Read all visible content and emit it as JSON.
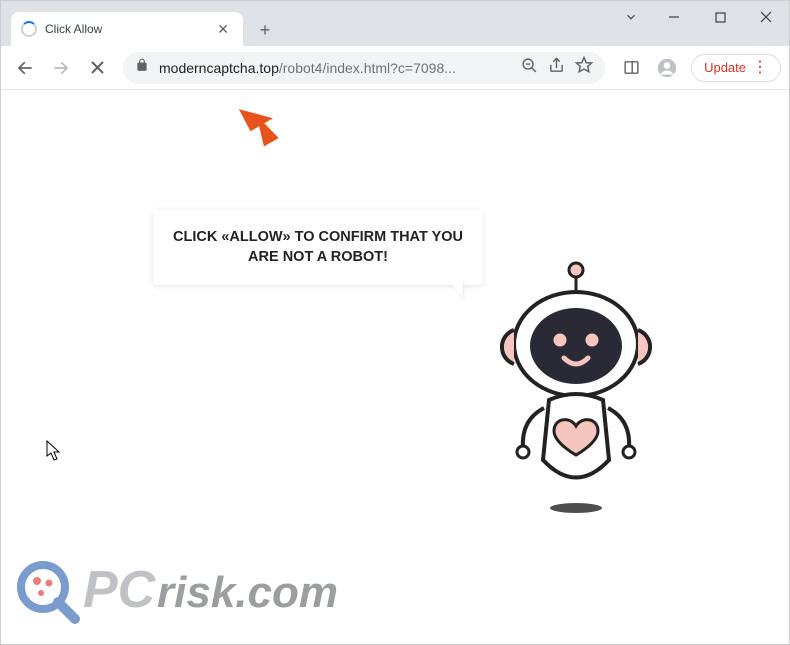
{
  "window": {
    "tab_title": "Click Allow",
    "url_domain": "moderncaptcha.top",
    "url_path": "/robot4/index.html?c=7098...",
    "update_label": "Update"
  },
  "page": {
    "speech_text": "CLICK «ALLOW» TO CONFIRM THAT YOU ARE NOT A ROBOT!"
  },
  "watermark": {
    "brand_prefix": "PC",
    "brand_suffix": "risk.com"
  }
}
